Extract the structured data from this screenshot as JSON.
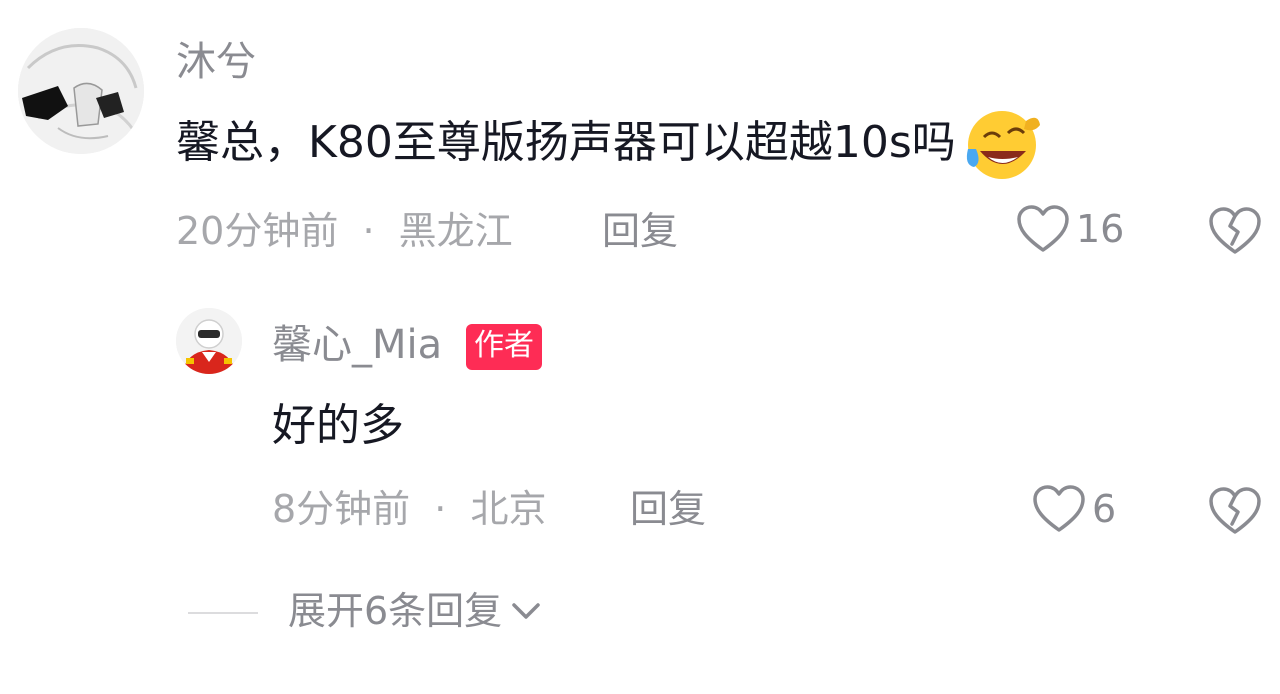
{
  "comment": {
    "username": "沐兮",
    "text": "馨总，K80至尊版扬声器可以超越10s吗",
    "emoji": "laughing-crying-emoji",
    "time": "20分钟前",
    "separator": "·",
    "location": "黑龙江",
    "reply_label": "回复",
    "likes": "16"
  },
  "reply": {
    "username": "馨心_Mia",
    "badge": "作者",
    "text": "好的多",
    "time": "8分钟前",
    "separator": "·",
    "location": "北京",
    "reply_label": "回复",
    "likes": "6"
  },
  "expand": {
    "label": "展开6条回复"
  },
  "colors": {
    "badge": "#fe2c55",
    "muted_text": "#8a8b91",
    "primary_text": "#161823"
  }
}
